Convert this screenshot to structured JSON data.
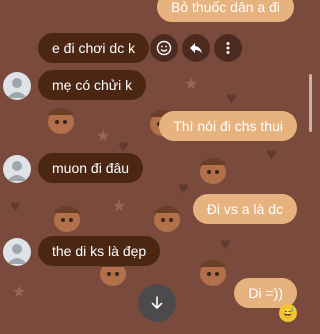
{
  "messages": [
    {
      "from": "me",
      "text": "Bỏ thuốc dân a đi"
    },
    {
      "from": "them",
      "text": "e đi chơi dc k"
    },
    {
      "from": "them",
      "text": "mẹ có chửi k"
    },
    {
      "from": "me",
      "text": "Thì nói đi chs thui"
    },
    {
      "from": "them",
      "text": "muon đi đâu"
    },
    {
      "from": "me",
      "text": "Đi vs a là dc"
    },
    {
      "from": "them",
      "text": "the di ks là đẹp"
    },
    {
      "from": "me",
      "text": "Di =))"
    }
  ],
  "message_actions": [
    "smiley-icon",
    "reply-icon",
    "more-options-icon"
  ],
  "reaction": "grinning-sweat-emoji",
  "colors": {
    "background": "#7a4b3d",
    "incoming_bubble": "#4a2613",
    "outgoing_bubble": "#e6b27e"
  }
}
